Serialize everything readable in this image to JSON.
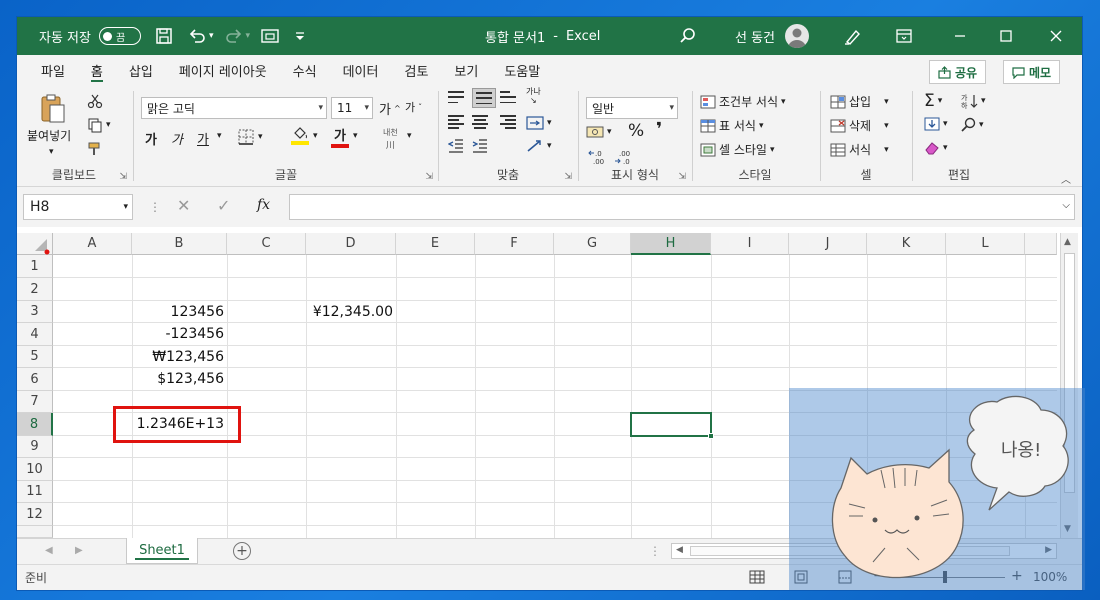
{
  "titlebar": {
    "autosave_label": "자동 저장",
    "autosave_state": "끔",
    "doc_title": "통합 문서1",
    "app_sep": "-",
    "app_name": "Excel",
    "user_name": "선 동건"
  },
  "menu": {
    "tabs": [
      "파일",
      "홈",
      "삽입",
      "페이지 레이아웃",
      "수식",
      "데이터",
      "검토",
      "보기",
      "도움말"
    ],
    "share_label": "공유",
    "comments_label": "메모"
  },
  "ribbon": {
    "clipboard": {
      "paste_label": "붙여넣기",
      "group_label": "클립보드"
    },
    "font": {
      "font_name": "맑은 고딕",
      "font_size": "11",
      "grow": "가",
      "shrink": "가",
      "bold": "가",
      "italic": "가",
      "underline": "가",
      "font_color_glyph": "가",
      "phonetic": "내천",
      "group_label": "글꼴"
    },
    "alignment": {
      "wrap_glyph": "가나",
      "group_label": "맞춤"
    },
    "number": {
      "format": "일반",
      "percent": "%",
      "comma": "❜",
      "inc_decimal": "←.0 .00",
      "dec_decimal": ".00 →.0",
      "group_label": "표시 형식"
    },
    "styles": {
      "conditional": "조건부 서식",
      "table": "표 서식",
      "cell_styles": "셀 스타일",
      "group_label": "스타일"
    },
    "cells": {
      "insert": "삽입",
      "delete": "삭제",
      "format": "서식",
      "group_label": "셀"
    },
    "editing": {
      "group_label": "편집"
    }
  },
  "formula_bar": {
    "name_box": "H8",
    "fx": "fx",
    "formula": ""
  },
  "grid": {
    "columns": [
      "A",
      "B",
      "C",
      "D",
      "E",
      "F",
      "G",
      "H",
      "I",
      "J",
      "K",
      "L"
    ],
    "rows": [
      "1",
      "2",
      "3",
      "4",
      "5",
      "6",
      "7",
      "8",
      "9",
      "10",
      "11",
      "12"
    ],
    "selected_column": "H",
    "selected_row": "8",
    "cells": {
      "B3": "123456",
      "B4": "-123456",
      "B5": "₩123,456",
      "B6": "$123,456",
      "B8": "1.2346E+13",
      "D3": "¥12,345.00"
    },
    "highlight_color": "#e0130f",
    "accent_color": "#217346"
  },
  "sheets": {
    "active": "Sheet1"
  },
  "status": {
    "ready": "준비",
    "zoom": "100%"
  },
  "overlay": {
    "speech": "나옹!"
  }
}
